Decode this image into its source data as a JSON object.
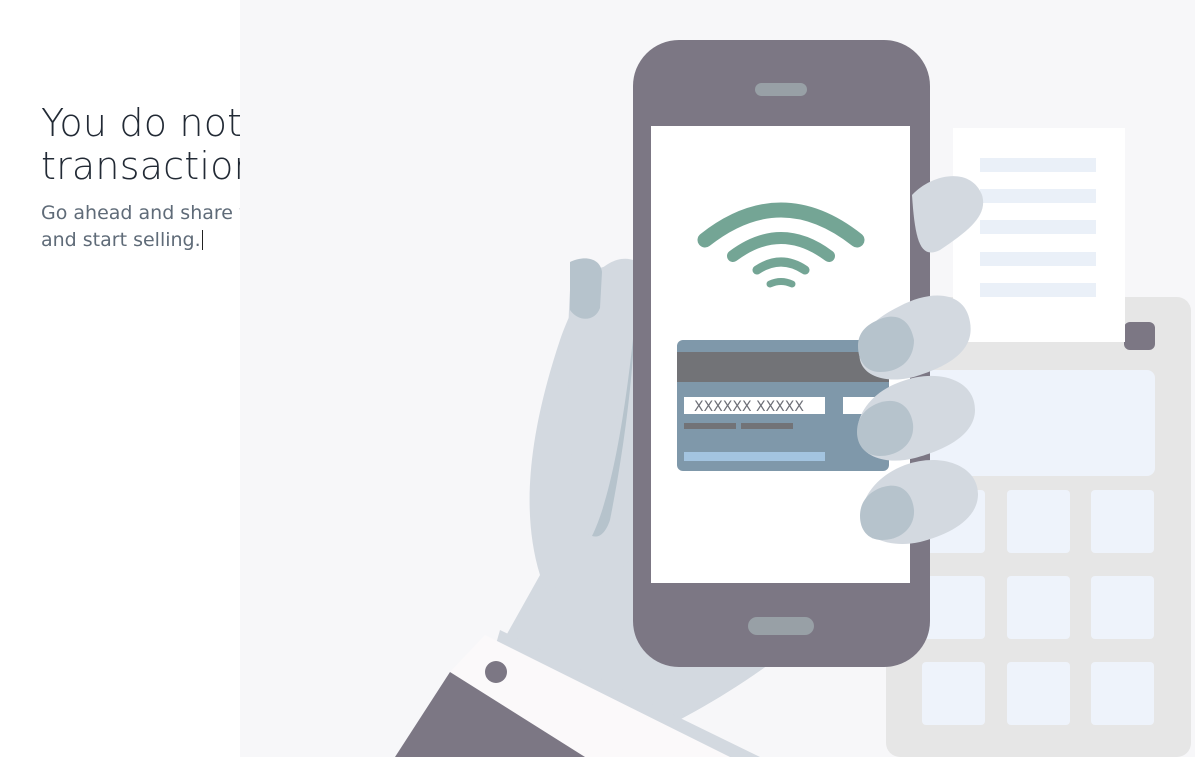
{
  "empty_state": {
    "title": "You do not have any transactions yet.",
    "subtitle": "Go ahead and share your payment pages and start selling."
  },
  "illustration": {
    "card_number": "XXXXXX XXXXX",
    "colors": {
      "panel_background": "#f7f7f9",
      "phone_body": "#7c7784",
      "hand": "#d3d9e0",
      "wifi": "#74a595",
      "card": "#7f98aa",
      "card_stripe": "#727377",
      "terminal": "#e6e6e6",
      "sleeve": "#7c7784"
    }
  }
}
